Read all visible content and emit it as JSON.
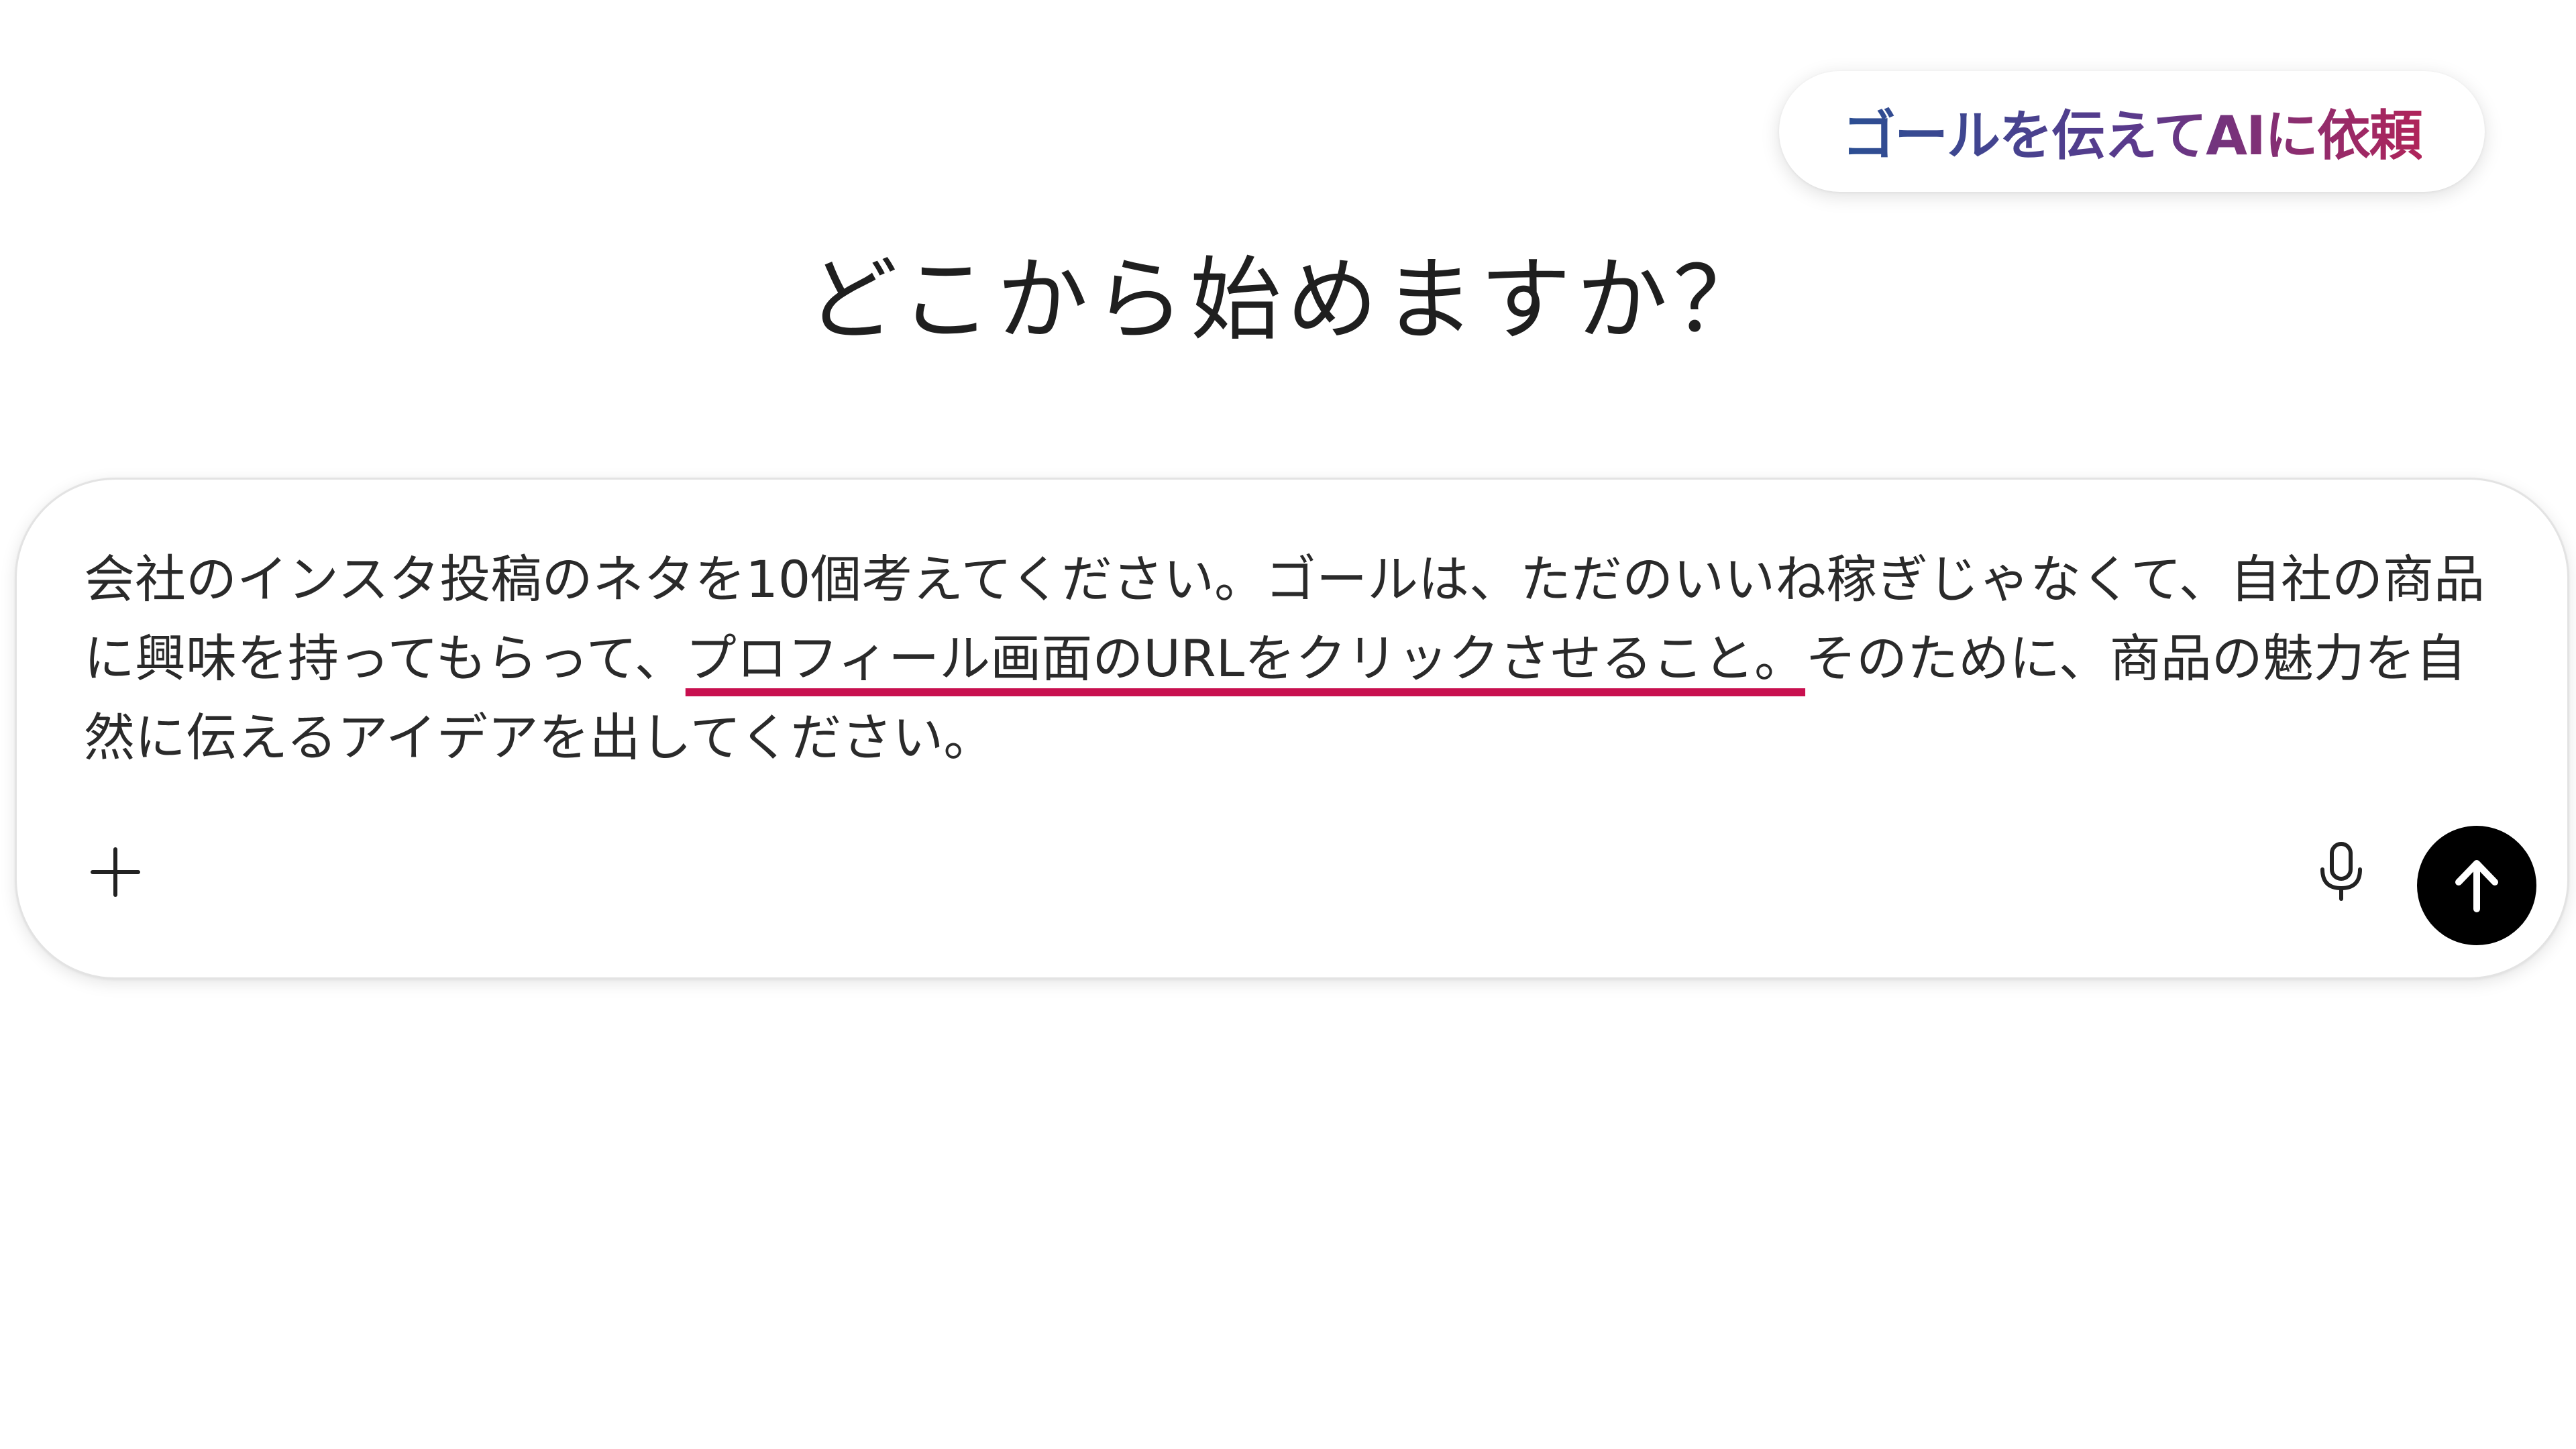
{
  "caption": {
    "text": "ゴールを伝えてAIに依頼",
    "gradient_colors": [
      "#2b4f93",
      "#5a3a8c",
      "#b0245a"
    ]
  },
  "main": {
    "heading": "どこから始めますか？"
  },
  "composer": {
    "text_before_highlight": "会社のインスタ投稿のネタを10個考えてください。ゴールは、ただのいいね稼ぎじゃなくて、自社の商品に興味を持ってもらって、",
    "text_highlight": "プロフィール画面のURLをクリックさせること。",
    "text_after_highlight": "そのために、商品の魅力を自然に伝えるアイデアを出してください。",
    "highlight_color": "#c8104f",
    "add_icon": "plus-icon",
    "mic_icon": "microphone-icon",
    "send_icon": "arrow-up-icon"
  }
}
